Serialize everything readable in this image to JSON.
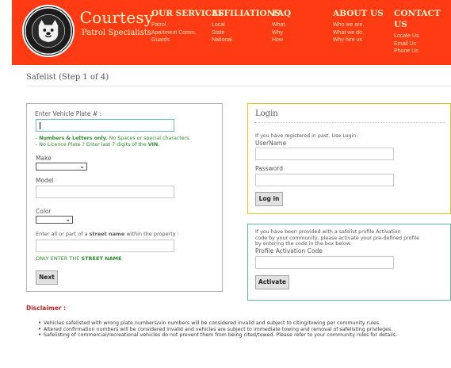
{
  "brand": {
    "name": "Courtesy",
    "subtitle": "Patrol Specialists",
    "logo_icon": "bulldog-badge-logo"
  },
  "nav": [
    {
      "title": "OUR SERVICES",
      "links": [
        "Patrol",
        "Apartment Comm.",
        "Guards"
      ]
    },
    {
      "title": "AFFILIATIONS",
      "links": [
        "Local",
        "State",
        "National"
      ]
    },
    {
      "title": "FAQ",
      "links": [
        "What",
        "Why",
        "How"
      ]
    },
    {
      "title": "ABOUT US",
      "links": [
        "Who we are.",
        "What we do.",
        "Why hire us"
      ]
    },
    {
      "title": "CONTACT US",
      "links": [
        "Locate Us",
        "Email Us",
        "Phone Us"
      ]
    }
  ],
  "page_title": "Safelist (Step 1 of 4)",
  "vehicle_form": {
    "plate_label": "Enter Vehicle Plate # :",
    "plate_value": "",
    "hint_line1_bold": "Numbers & Letters only.",
    "hint_line1_rest": " No Spaces or special characters.",
    "hint_line2_prefix": "- No Licence Plate ? Enter last 7 digits of the ",
    "hint_line2_bold": "VIN",
    "hint_line2_suffix": ".",
    "make_label": "Make",
    "make_value": "",
    "model_label": "Model",
    "model_value": "",
    "color_label": "Color",
    "color_value": "",
    "street_label_prefix": "Enter all or part of a ",
    "street_label_bold": "street name",
    "street_label_suffix": " within the property :",
    "street_value": "",
    "street_hint_prefix": "ONLY ENTER THE ",
    "street_hint_bold": "STREET NAME",
    "next_button": "Next"
  },
  "login": {
    "title": "Login",
    "info": "If you have registered in past. Use Login.",
    "username_label": "UserName",
    "username_value": "",
    "password_label": "Password",
    "password_value": "",
    "login_button": "Log in"
  },
  "activation": {
    "info_line1": "If you have been provided with a safelist profile Activation",
    "info_line2": "code by your community, please activate your pre-defined profile",
    "info_line3": "by entering the code in the box below.",
    "code_label": "Profile Activation Code",
    "code_value": "",
    "activate_button": "Activate"
  },
  "disclaimer": {
    "title": "Disclaimer :",
    "items": [
      "Vehicles safelisted with wrong plate numbers/vin numbers will be considered invalid and subject to citing/towing per community rules.",
      "Altered confirmation numbers will be considered invalid and vehicles are subject to immediate towing and removal of safelisting privileges.",
      "Safelisting of commercial/recreational vehicles do not prevent them from being cited/towed. Please refer to your community rules for details."
    ]
  },
  "colors": {
    "header_bg": "#ff3b14",
    "login_border": "#e2c227",
    "activation_border": "#63b89a",
    "hint_green": "#2e8b2e",
    "disclaimer_red": "#cc2222"
  }
}
